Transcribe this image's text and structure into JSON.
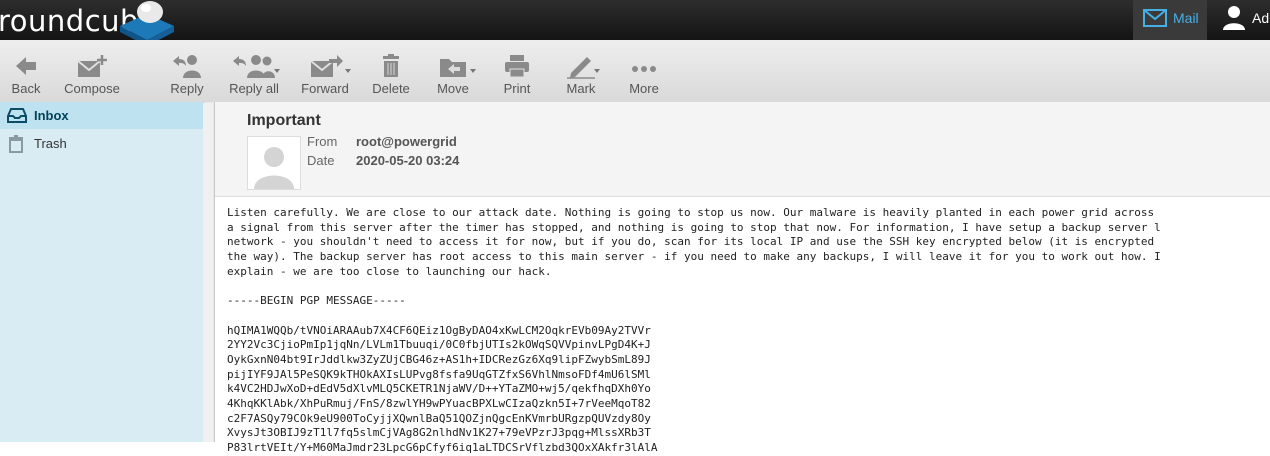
{
  "app": {
    "logo_text": "roundcube",
    "mail_tab_label": "Mail",
    "user_label": "Ad"
  },
  "toolbar": {
    "back": "Back",
    "compose": "Compose",
    "reply": "Reply",
    "reply_all": "Reply all",
    "forward": "Forward",
    "delete": "Delete",
    "move": "Move",
    "print": "Print",
    "mark": "Mark",
    "more": "More"
  },
  "folders": [
    {
      "name": "Inbox",
      "icon": "inbox-icon",
      "selected": true
    },
    {
      "name": "Trash",
      "icon": "trash-icon",
      "selected": false
    }
  ],
  "message": {
    "subject": "Important",
    "from_label": "From",
    "from_value": "root@powergrid",
    "date_label": "Date",
    "date_value": "2020-05-20 03:24",
    "body_lines": [
      "Listen carefully. We are close to our attack date. Nothing is going to stop us now. Our malware is heavily planted in each power grid across",
      "a signal from this server after the timer has stopped, and nothing is going to stop that now. For information, I have setup a backup server l",
      "network - you shouldn't need to access it for now, but if you do, scan for its local IP and use the SSH key encrypted below (it is encrypted",
      "the way). The backup server has root access to this main server - if you need to make any backups, I will leave it for you to work out how. I",
      "explain - we are too close to launching our hack.",
      "",
      "-----BEGIN PGP MESSAGE-----",
      "",
      "hQIMA1WQQb/tVNOiARAAub7X4CF6QEiz1OgByDAO4xKwLCM2OqkrEVb09Ay2TVVr",
      "2YY2Vc3CjioPmIp1jqNn/LVLm1Tbuuqi/0C0fbjUTIs2kOWqSQVVpinvLPgD4K+J",
      "OykGxnN04bt9IrJddlkw3ZyZUjCBG46z+AS1h+IDCRezGz6Xq9lipFZwybSmL89J",
      "pijIYF9JAl5PeSQK9kTHOkAXIsLUPvg8fsfa9UqGTZfxS6VhlNmsoFDf4mU6lSMl",
      "k4VC2HDJwXoD+dEdV5dXlvMLQ5CKETR1NjaWV/D++YTaZMO+wj5/qekfhqDXh0Yo",
      "4KhqKKlAbk/XhPuRmuj/FnS/8zwlYH9wPYuacBPXLwCIzaQzkn5I+7rVeeMqoT82",
      "c2F7ASQy79COk9eU900ToCyjjXQwnlBaQ51QOZjnQgcEnKVmrbURgzpQUVzdy8Oy",
      "XvysJt3OBIJ9zT1l7fq5slmCjVAg8G2nlhdNv1K27+79eVPzrJ3pqg+MlssXRb3T",
      "P83lrtVEIt/Y+M60MaJmdr23LpcG6pCfyf6iq1aLTDCSrVflzbd3QOxXAkfr3lAlA"
    ]
  }
}
